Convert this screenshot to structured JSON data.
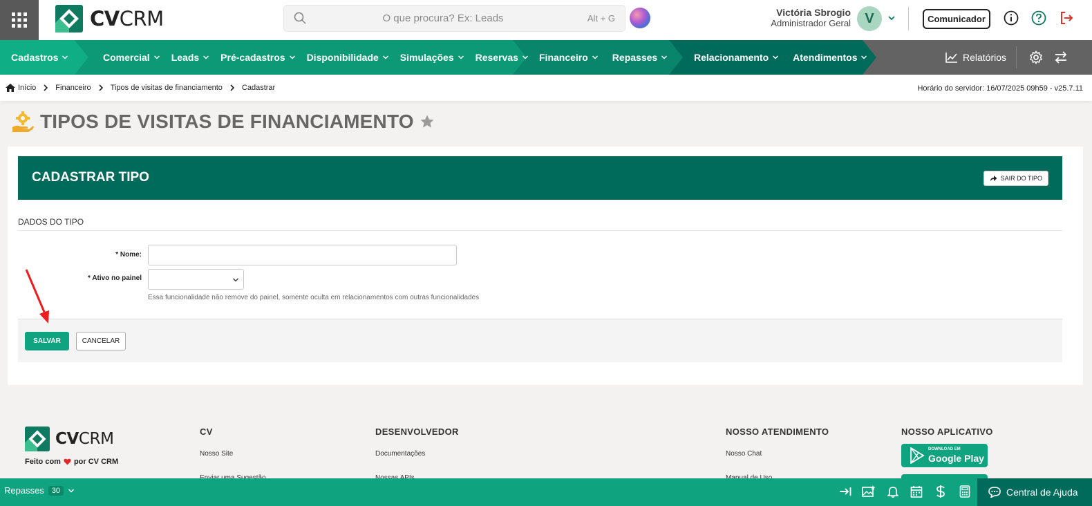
{
  "app": {
    "logo_part1": "CV",
    "logo_part2": "CRM"
  },
  "search": {
    "placeholder": "O que procura? Ex: Leads",
    "shortcut": "Alt + G"
  },
  "user": {
    "name": "Victória Sbrogio",
    "role": "Administrador Geral",
    "initial": "V"
  },
  "topbar": {
    "communicator_label": "Comunicador"
  },
  "nav": {
    "segment1": [
      {
        "label": "Cadastros"
      }
    ],
    "segment2": [
      {
        "label": "Comercial"
      },
      {
        "label": "Leads"
      },
      {
        "label": "Pré-cadastros"
      },
      {
        "label": "Disponibilidade"
      },
      {
        "label": "Simulações"
      },
      {
        "label": "Reservas"
      }
    ],
    "segment3": [
      {
        "label": "Financeiro"
      },
      {
        "label": "Repasses"
      }
    ],
    "segment4": [
      {
        "label": "Relacionamento"
      },
      {
        "label": "Atendimentos"
      }
    ],
    "reports_label": "Relatórios"
  },
  "breadcrumb": {
    "items": [
      "Início",
      "Financeiro",
      "Tipos de visitas de financiamento",
      "Cadastrar"
    ],
    "server_time": "Horário do servidor: 16/07/2025 09h59 - v25.7.11"
  },
  "page": {
    "title": "TIPOS DE VISITAS DE FINANCIAMENTO"
  },
  "form": {
    "header_title": "CADASTRAR TIPO",
    "exit_label": "SAIR DO TIPO",
    "section_title": "DADOS DO TIPO",
    "name_label": "* Nome:",
    "name_value": "",
    "active_label": "* Ativo no painel",
    "active_value": "",
    "active_help": "Essa funcionalidade não remove do painel, somente oculta em relacionamentos com outras funcionalidades",
    "save_label": "SALVAR",
    "cancel_label": "CANCELAR"
  },
  "footer": {
    "made_with_prefix": "Feito com",
    "made_with_suffix": "por CV CRM",
    "col_cv_title": "CV",
    "col_cv_links": [
      "Nosso Site",
      "Enviar uma Sugestão"
    ],
    "col_dev_title": "DESENVOLVEDOR",
    "col_dev_links": [
      "Documentações",
      "Nossas APIs"
    ],
    "col_support_title": "NOSSO ATENDIMENTO",
    "col_support_links": [
      "Nosso Chat",
      "Manual de Uso"
    ],
    "col_app_title": "NOSSO APLICATIVO",
    "google_play_small": "DOWNLOAD EM",
    "google_play_label": "Google Play"
  },
  "bottombar": {
    "label": "Repasses",
    "count": "30",
    "help_center_label": "Central de Ajuda"
  },
  "colors": {
    "primary_green": "#10a37f",
    "dark_green": "#006b5b",
    "nav_gray": "#636363"
  }
}
